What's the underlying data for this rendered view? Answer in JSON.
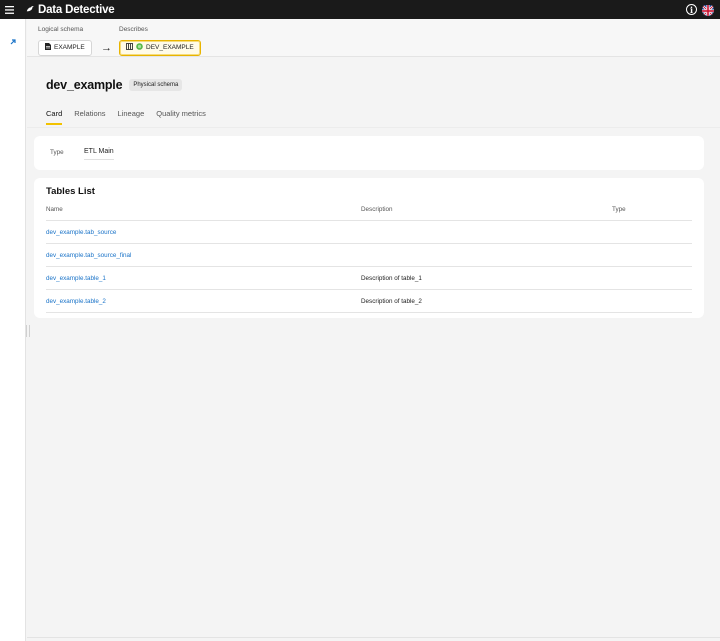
{
  "app": {
    "name": "Data Detective"
  },
  "breadcrumb": {
    "logical_label": "Logical schema",
    "logical_value": "EXAMPLE",
    "describes_label": "Describes",
    "describes_value": "DEV_EXAMPLE"
  },
  "page": {
    "title": "dev_example",
    "badge": "Physical schema"
  },
  "tabs": [
    {
      "label": "Card",
      "active": true
    },
    {
      "label": "Relations",
      "active": false
    },
    {
      "label": "Lineage",
      "active": false
    },
    {
      "label": "Quality metrics",
      "active": false
    }
  ],
  "type_card": {
    "label": "Type",
    "value": "ETL Main"
  },
  "tables_list": {
    "title": "Tables List",
    "columns": [
      "Name",
      "Description",
      "Type"
    ],
    "rows": [
      {
        "name": "dev_example.tab_source",
        "description": "",
        "type": ""
      },
      {
        "name": "dev_example.tab_source_final",
        "description": "",
        "type": ""
      },
      {
        "name": "dev_example.table_1",
        "description": "Description of table_1",
        "type": ""
      },
      {
        "name": "dev_example.table_2",
        "description": "Description of table_2",
        "type": ""
      }
    ]
  },
  "icons": {
    "menu": "hamburger-icon",
    "brand": "bird-logo-icon",
    "info": "info-icon",
    "language": "uk-flag-icon",
    "rail": "external-link-icon",
    "logical": "document-icon",
    "physical": "database-icon",
    "status": "green-status-icon",
    "arrow": "arrow-right-icon"
  },
  "colors": {
    "accent": "#f2c200",
    "link": "#1a73c8",
    "topbar": "#1a1a1a"
  }
}
